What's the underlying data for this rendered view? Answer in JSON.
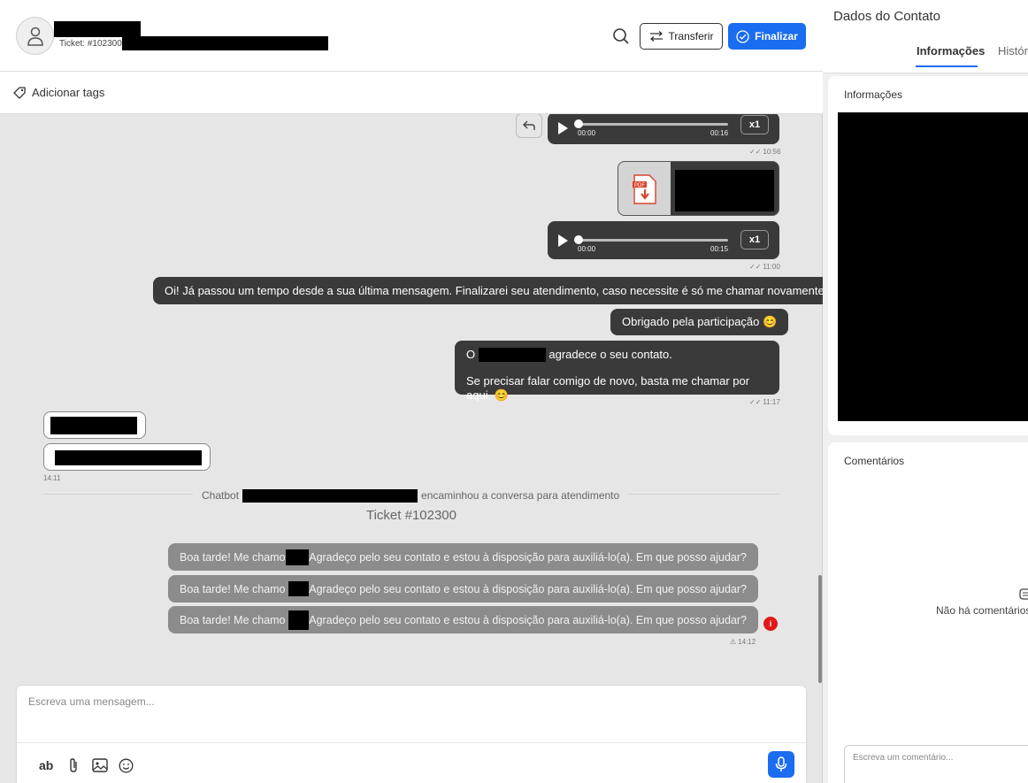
{
  "header": {
    "ticket_label": "Ticket: #102300",
    "transfer_label": "Transferir",
    "finalize_label": "Finalizar"
  },
  "tags_bar": {
    "add_tags_label": "Adicionar tags"
  },
  "messages": {
    "audio1": {
      "start": "00:00",
      "end": "00:16",
      "speed": "x1",
      "time": "10:56"
    },
    "audio2": {
      "start": "00:00",
      "end": "00:15",
      "speed": "x1",
      "time": "11:00"
    },
    "msg_inactivity": "Oi! Já passou um tempo desde a sua última mensagem. Finalizarei seu atendimento, caso necessite é só me chamar novamente!",
    "msg_thanks": "Obrigado pela participação 😊",
    "msg_closing_prefix": "O",
    "msg_closing_suffix": "agradece o seu contato.",
    "msg_closing_line2": "Se precisar falar comigo de novo, basta me chamar por aqui. 😊",
    "closing_time": "11:17",
    "incoming_time": "14:11",
    "chatbot_prefix": "Chatbot",
    "chatbot_suffix": "encaminhou a conversa para atendimento",
    "ticket_center": "Ticket #102300",
    "greeting_prefix": "Boa tarde! Me chamo",
    "greeting_suffix": "Agradeço pelo seu contato e estou à disposição para auxiliá-lo(a). Em que posso ajudar?",
    "error_badge": "i",
    "failed_time": "14:12"
  },
  "composer": {
    "placeholder": "Escreva uma mensagem...",
    "format_label": "ab"
  },
  "right_panel": {
    "title": "Dados do Contato",
    "tabs": [
      "Informações",
      "Histórico"
    ],
    "info_title": "Informações",
    "comments_title": "Comentários",
    "no_comments": "Não há comentários",
    "comment_placeholder": "Escreva um comentário..."
  },
  "colors": {
    "accent": "#1a6cf0",
    "bubble_dark": "#3a3a3a",
    "bubble_failed": "#8c8c8c",
    "error": "#e01818"
  }
}
